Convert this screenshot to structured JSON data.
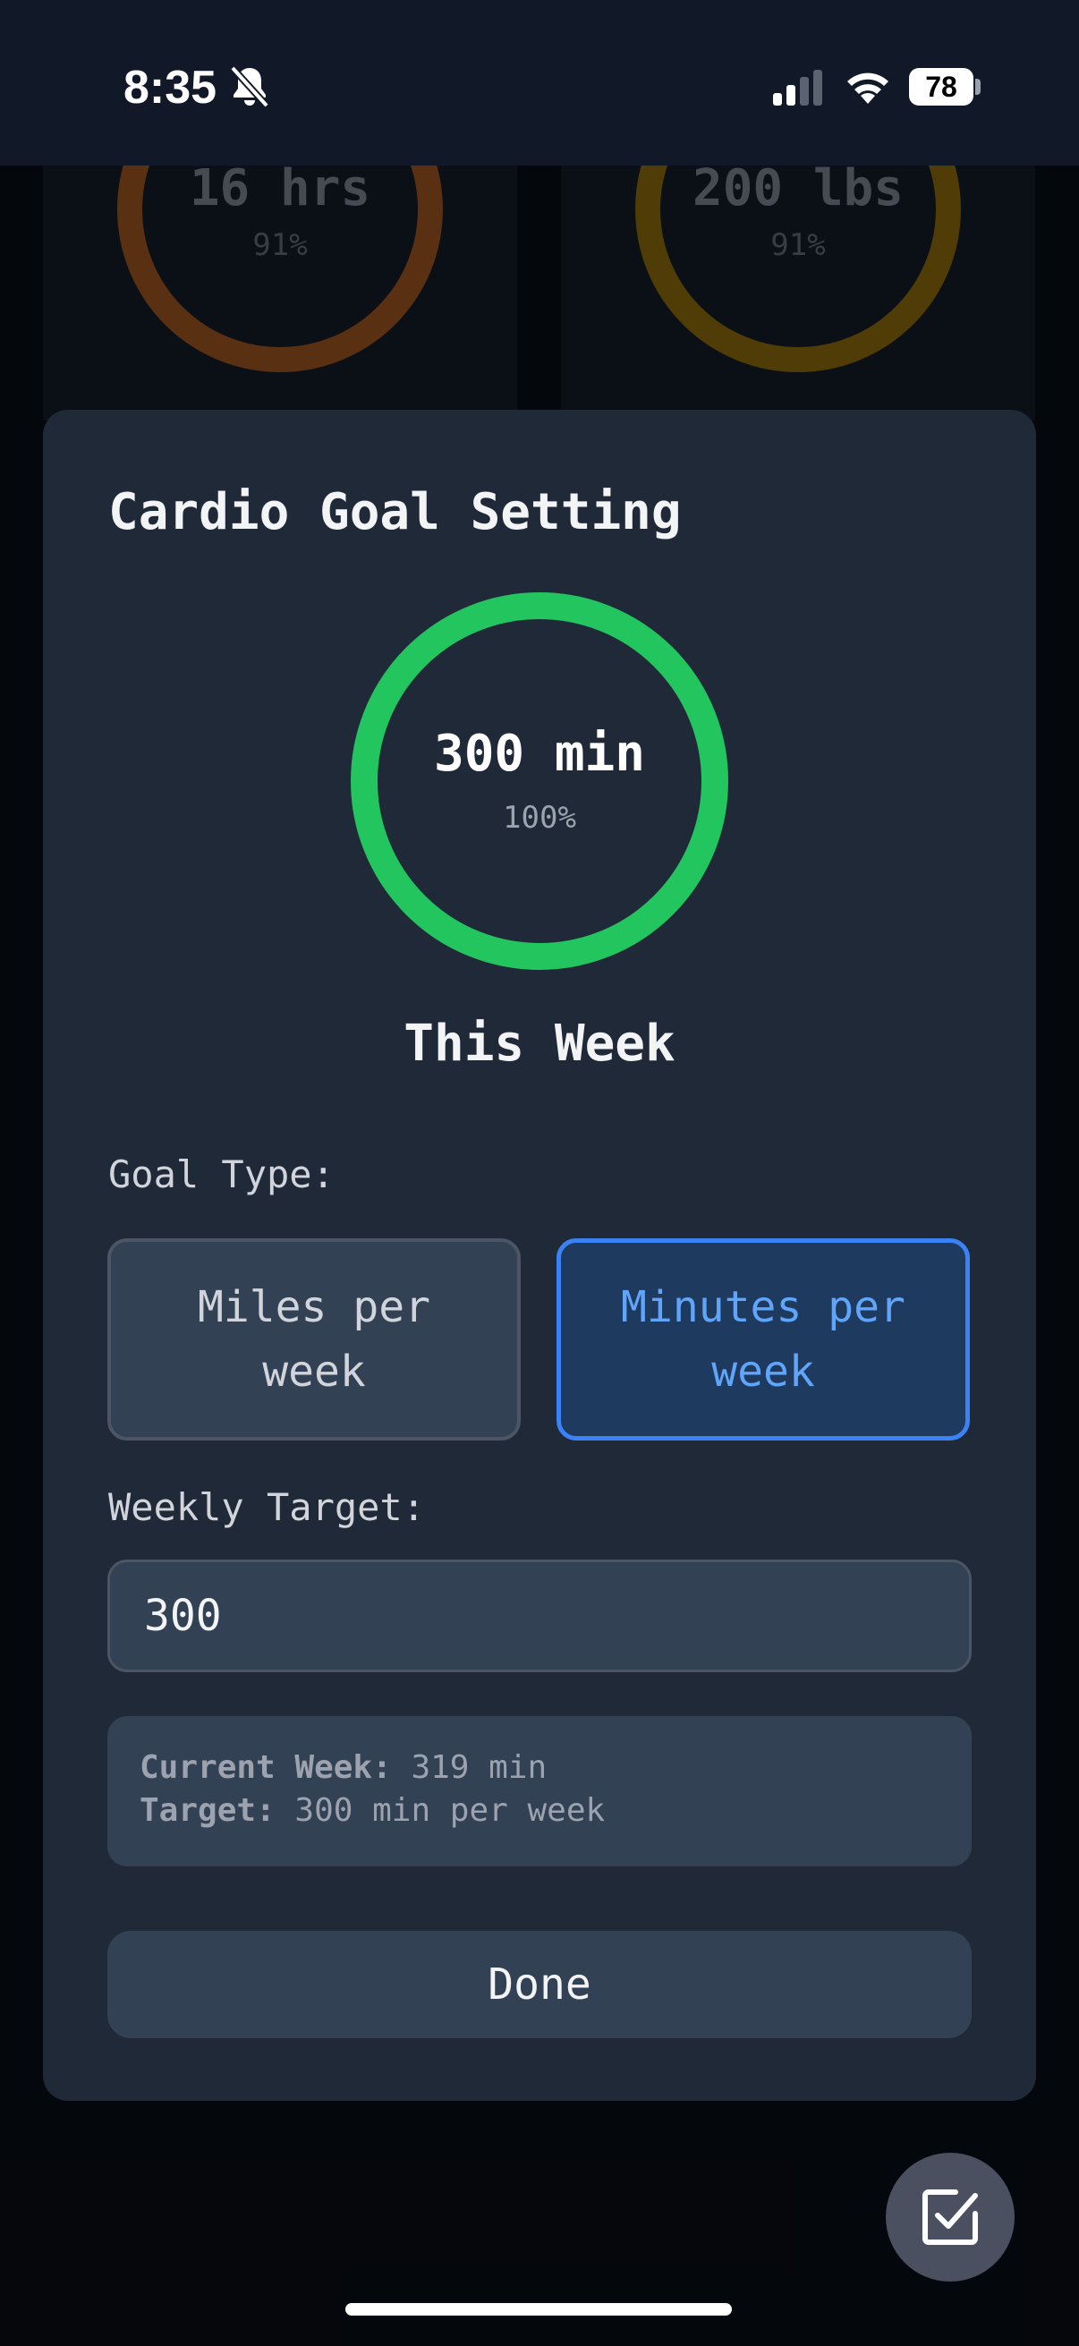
{
  "status_bar": {
    "time": "8:35",
    "battery": "78"
  },
  "background_cards": [
    {
      "value": "16 hrs",
      "percent": "91%",
      "color": "#8a4a1e"
    },
    {
      "value": "200 lbs",
      "percent": "91%",
      "color": "#7a5c0a"
    }
  ],
  "modal": {
    "title": "Cardio Goal Setting",
    "progress": {
      "value": "300 min",
      "percent": "100%",
      "fraction": 1.0,
      "color": "#22c55e"
    },
    "period_label": "This Week",
    "goal_type_label": "Goal Type:",
    "options": [
      {
        "label": "Miles per week",
        "selected": false
      },
      {
        "label": "Minutes per week",
        "selected": true
      }
    ],
    "weekly_target_label": "Weekly Target:",
    "weekly_target_value": "300",
    "summary": {
      "current_label": "Current Week:",
      "current_value": "319 min",
      "target_label": "Target:",
      "target_value": "300 min per week"
    },
    "done_label": "Done"
  },
  "fab": {
    "icon": "checkbox-edit-icon"
  },
  "colors": {
    "accent_blue": "#3b82f6",
    "success_green": "#22c55e"
  }
}
